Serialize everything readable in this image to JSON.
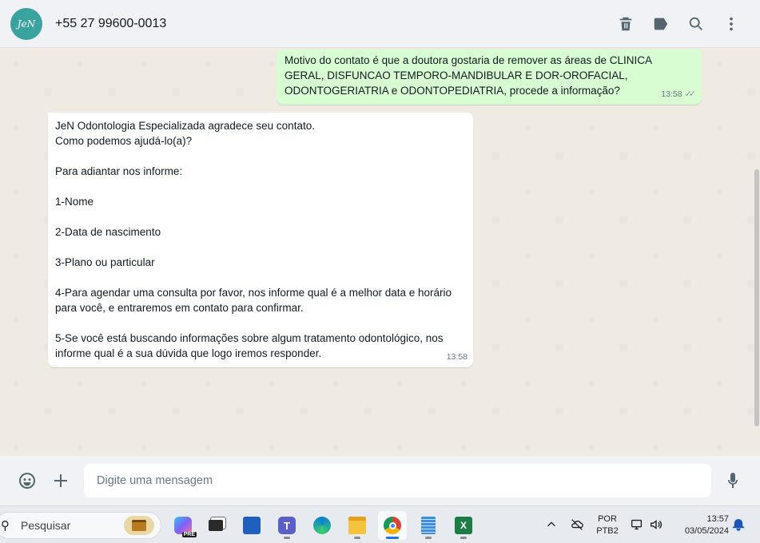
{
  "header": {
    "avatar_text": "JeN",
    "contact": "+55 27 99600-0013",
    "icons": [
      "delete-icon",
      "label-icon",
      "search-icon",
      "menu-icon"
    ]
  },
  "messages": {
    "outgoing": {
      "text": "Motivo do contato é que a doutora gostaria de remover as áreas de CLINICA GERAL, DISFUNCAO TEMPORO-MANDIBULAR E DOR-OROFACIAL, ODONTOGERIATRIA e ODONTOPEDIATRIA, procede a informação?",
      "time": "13:58",
      "ticks": "✓✓"
    },
    "incoming": {
      "text": "JeN Odontologia Especializada agradece seu contato.\nComo podemos ajudá-lo(a)?\n\nPara adiantar nos informe:\n\n1-Nome\n\n2-Data de nascimento\n\n3-Plano ou particular\n\n4-Para agendar uma consulta por favor, nos informe qual é a melhor data e horário para você, e entraremos em contato para confirmar.\n\n5-Se você está buscando informações sobre algum tratamento odontológico, nos informe qual é a sua dúvida que logo iremos responder.",
      "time": "13:58"
    }
  },
  "composer": {
    "placeholder": "Digite uma mensagem"
  },
  "taskbar": {
    "search_label": "Pesquisar",
    "language_line1": "POR",
    "language_line2": "PTB2",
    "time": "13:57",
    "date": "03/05/2024",
    "copilot_badge": "PRE",
    "colors": {
      "accent": "#1a73e8",
      "chat_bg": "#efeae2",
      "outgoing_bubble": "#d9fdd3",
      "incoming_bubble": "#ffffff"
    }
  }
}
